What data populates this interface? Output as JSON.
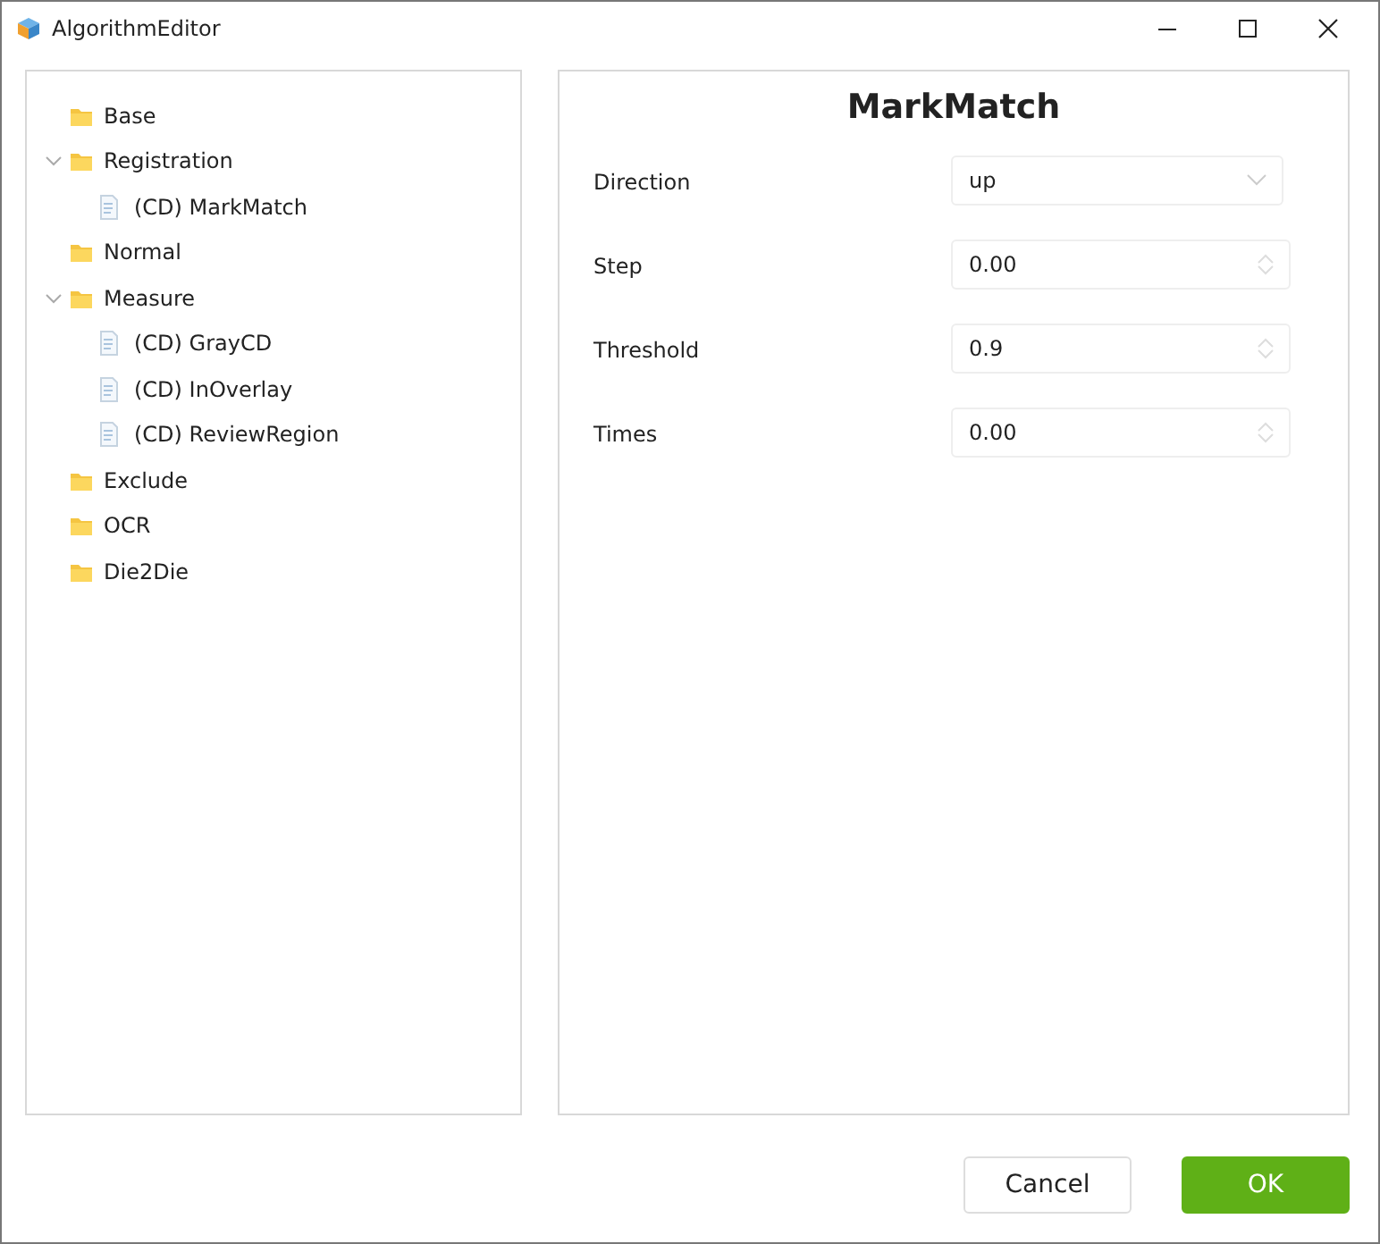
{
  "window": {
    "title": "AlgorithmEditor"
  },
  "tree": [
    {
      "label": "Base",
      "kind": "folder",
      "expanded": false
    },
    {
      "label": "Registration",
      "kind": "folder",
      "expanded": true,
      "children": [
        {
          "label": "(CD) MarkMatch",
          "kind": "file"
        }
      ]
    },
    {
      "label": "Normal",
      "kind": "folder",
      "expanded": false
    },
    {
      "label": "Measure",
      "kind": "folder",
      "expanded": true,
      "children": [
        {
          "label": "(CD) GrayCD",
          "kind": "file"
        },
        {
          "label": "(CD) InOverlay",
          "kind": "file"
        },
        {
          "label": "(CD) ReviewRegion",
          "kind": "file"
        }
      ]
    },
    {
      "label": "Exclude",
      "kind": "folder",
      "expanded": false
    },
    {
      "label": "OCR",
      "kind": "folder",
      "expanded": false
    },
    {
      "label": "Die2Die",
      "kind": "folder",
      "expanded": false
    }
  ],
  "form": {
    "title": "MarkMatch",
    "fields": [
      {
        "label": "Direction",
        "kind": "select",
        "value": "up"
      },
      {
        "label": "Step",
        "kind": "spinner",
        "value": "0.00"
      },
      {
        "label": "Threshold",
        "kind": "spinner",
        "value": "0.9"
      },
      {
        "label": "Times",
        "kind": "spinner",
        "value": "0.00"
      }
    ]
  },
  "buttons": [
    {
      "label": "Cancel",
      "kind": "secondary"
    },
    {
      "label": "OK",
      "kind": "primary"
    }
  ]
}
